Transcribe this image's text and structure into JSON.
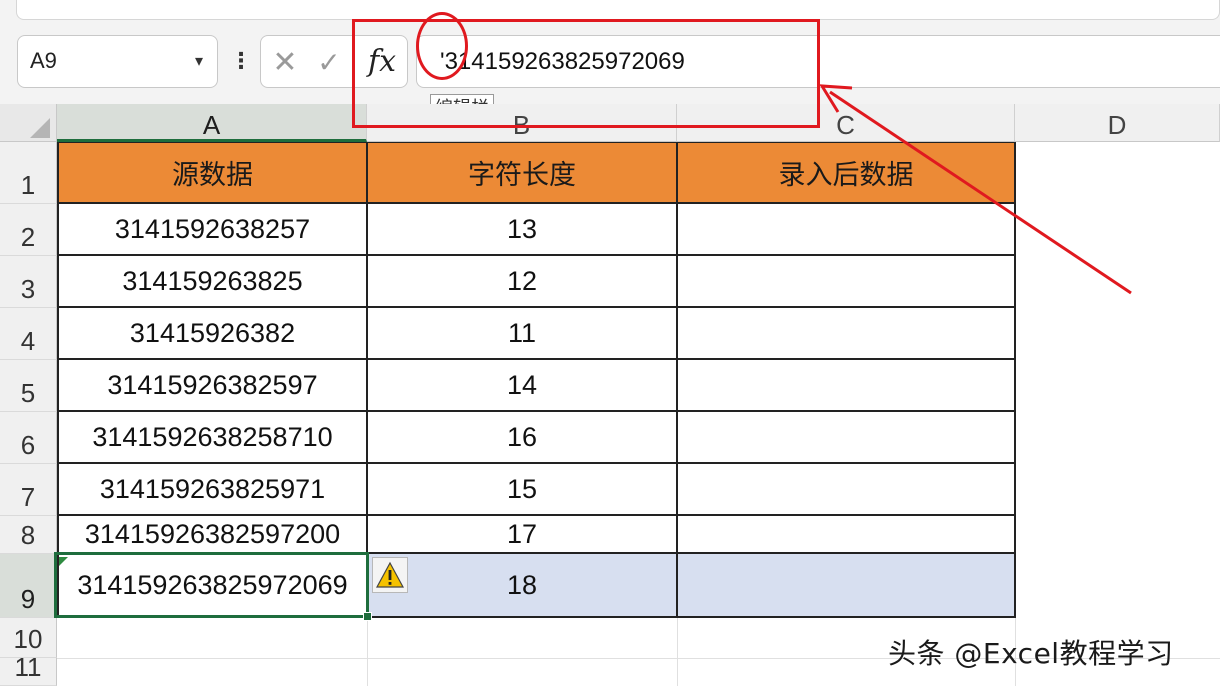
{
  "name_box": {
    "value": "A9"
  },
  "formula_bar": {
    "content": "'314159263825972069",
    "fx_label": "fx",
    "tooltip": "编辑栏"
  },
  "columns": [
    "A",
    "B",
    "C",
    "D"
  ],
  "rows": [
    "1",
    "2",
    "3",
    "4",
    "5",
    "6",
    "7",
    "8",
    "9",
    "10",
    "11"
  ],
  "table": {
    "headers": [
      "源数据",
      "字符长度",
      "录入后数据"
    ],
    "rows": [
      [
        "3141592638257",
        "13",
        ""
      ],
      [
        "314159263825",
        "12",
        ""
      ],
      [
        "31415926382",
        "11",
        ""
      ],
      [
        "31415926382597",
        "14",
        ""
      ],
      [
        "3141592638258710",
        "16",
        ""
      ],
      [
        "314159263825971",
        "15",
        ""
      ],
      [
        "31415926382597200",
        "17",
        ""
      ],
      [
        "314159263825972069",
        "18",
        ""
      ]
    ]
  },
  "icons": {
    "namebox_dropdown": "chevron-down-icon",
    "more": "kebab-icon",
    "cancel": "cancel-x-icon",
    "enter": "checkmark-icon",
    "insert_function": "fx-icon",
    "warning": "warning-icon"
  },
  "colors": {
    "header_fill": "#ec8a36",
    "selection_highlight": "#d7dff0",
    "active_border": "#1e6d3d",
    "annotation_red": "#e0191f"
  },
  "watermark": "头条 @Excel教程学习"
}
